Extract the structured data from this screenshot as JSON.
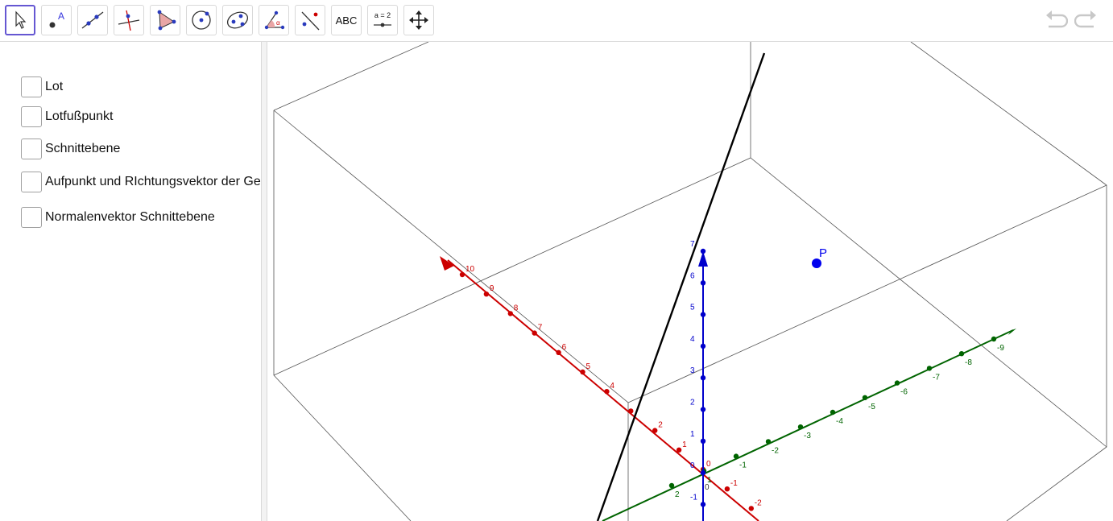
{
  "toolbar": {
    "tools": [
      {
        "name": "move-tool",
        "icon": "pointer-arrow-icon",
        "active": true
      },
      {
        "name": "point-tool",
        "icon": "point-icon",
        "label": "A"
      },
      {
        "name": "line-tool",
        "icon": "line-icon"
      },
      {
        "name": "perpendicular-line-tool",
        "icon": "perpendicular-line-icon"
      },
      {
        "name": "polygon-tool",
        "icon": "polygon-icon"
      },
      {
        "name": "circle-tool",
        "icon": "circle-icon"
      },
      {
        "name": "conic-tool",
        "icon": "ellipse-icon"
      },
      {
        "name": "angle-tool",
        "icon": "angle-icon",
        "label": "α"
      },
      {
        "name": "reflect-tool",
        "icon": "reflect-about-line-icon"
      },
      {
        "name": "text-tool",
        "icon": "text-icon",
        "label": "ABC"
      },
      {
        "name": "slider-tool",
        "icon": "slider-icon",
        "label": "a = 2"
      },
      {
        "name": "move-graphics-view-tool",
        "icon": "move-arrows-icon"
      }
    ],
    "undo_icon": "undo-icon",
    "redo_icon": "redo-icon"
  },
  "algebra": {
    "checkboxes": [
      {
        "label": "Lot"
      },
      {
        "label": "Lotfußpunkt"
      },
      {
        "label": "Schnittebene"
      },
      {
        "label": "Aufpunkt und RIchtungsvektor der Gerade"
      },
      {
        "label": "Normalenvektor Schnittebene"
      }
    ]
  },
  "view3d": {
    "point_label": "P",
    "x_ticks": [
      "10",
      "9",
      "8",
      "7",
      "6",
      "5",
      "4",
      "",
      "2",
      "1",
      "0",
      "-1",
      "-2"
    ],
    "y_ticks": [
      "-9",
      "-8",
      "-7",
      "-6",
      "-5",
      "-4",
      "-3",
      "-2",
      "-1",
      "1",
      "2"
    ],
    "z_ticks": [
      "7",
      "6",
      "5",
      "4",
      "3",
      "2",
      "1",
      "0",
      "-1"
    ],
    "origin_label": "0",
    "colors": {
      "x_axis": "#cc0000",
      "y_axis": "#006400",
      "z_axis": "#0000cc",
      "point": "#0000ee",
      "line": "#000000",
      "accent": "#6557d2"
    }
  }
}
